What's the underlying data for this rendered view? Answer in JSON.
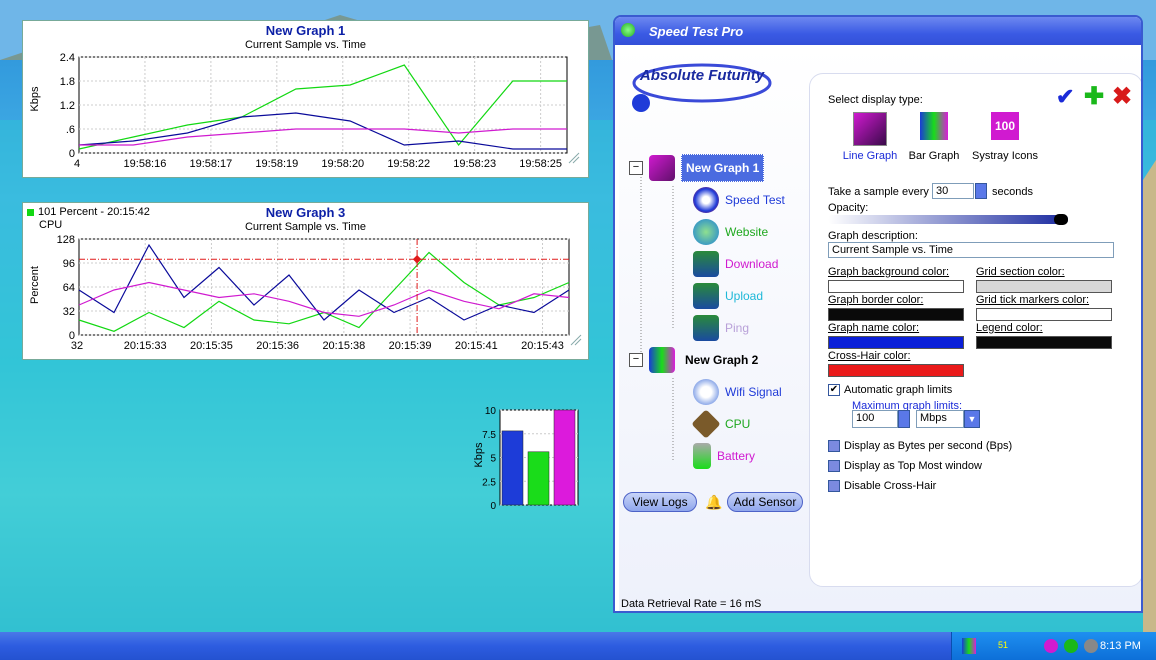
{
  "graph1": {
    "title": "New Graph 1",
    "subtitle": "Current Sample vs. Time",
    "ylabel": "Kbps",
    "yticks": [
      "2.4",
      "1.8",
      "1.2",
      ".6",
      "0"
    ],
    "xticks": [
      "4",
      "19:58:16",
      "19:58:17",
      "19:58:19",
      "19:58:20",
      "19:58:22",
      "19:58:23",
      "19:58:25"
    ]
  },
  "graph3": {
    "title": "New Graph 3",
    "subtitle": "Current Sample vs. Time",
    "status": "101 Percent - 20:15:42",
    "status_sub": "CPU",
    "ylabel": "Percent",
    "yticks": [
      "128",
      "96",
      "64",
      "32",
      "0"
    ],
    "xticks": [
      "32",
      "20:15:33",
      "20:15:35",
      "20:15:36",
      "20:15:38",
      "20:15:39",
      "20:15:41",
      "20:15:43"
    ]
  },
  "bar_widget": {
    "ylabel": "Kbps",
    "yticks": [
      "10",
      "7.5",
      "5",
      "2.5",
      "0"
    ]
  },
  "chart_data": [
    {
      "type": "line",
      "title": "New Graph 1",
      "subtitle": "Current Sample vs. Time",
      "ylabel": "Kbps",
      "ylim": [
        0,
        2.4
      ],
      "x": [
        "19:58:16",
        "19:58:17",
        "19:58:19",
        "19:58:20",
        "19:58:22",
        "19:58:23",
        "19:58:25"
      ],
      "series": [
        {
          "values": [
            0.1,
            0.4,
            0.7,
            0.9,
            1.6,
            1.7,
            2.2,
            0.2,
            1.8,
            1.8
          ],
          "color": "#12d812"
        },
        {
          "values": [
            0.2,
            0.3,
            0.5,
            0.9,
            1.0,
            0.8,
            0.2,
            0.3,
            0.1,
            0.1
          ],
          "color": "#0a0a9a"
        },
        {
          "values": [
            0.2,
            0.2,
            0.4,
            0.5,
            0.6,
            0.6,
            0.6,
            0.5,
            0.6,
            0.6
          ],
          "color": "#d01ad0"
        }
      ]
    },
    {
      "type": "line",
      "title": "New Graph 3",
      "subtitle": "Current Sample vs. Time",
      "ylabel": "Percent",
      "ylim": [
        0,
        128
      ],
      "x": [
        "20:15:33",
        "20:15:35",
        "20:15:36",
        "20:15:38",
        "20:15:39",
        "20:15:41",
        "20:15:43"
      ],
      "crosshair_value": 101,
      "series": [
        {
          "values": [
            20,
            5,
            30,
            10,
            45,
            20,
            15,
            30,
            10,
            60,
            110,
            70,
            40,
            50,
            70
          ],
          "color": "#12d812"
        },
        {
          "values": [
            60,
            30,
            120,
            50,
            90,
            40,
            80,
            20,
            60,
            30,
            50,
            20,
            40,
            30,
            60
          ],
          "color": "#0a0a9a"
        },
        {
          "values": [
            40,
            60,
            70,
            60,
            50,
            55,
            45,
            30,
            25,
            40,
            60,
            45,
            35,
            55,
            50
          ],
          "color": "#d01ad0"
        }
      ]
    },
    {
      "type": "bar",
      "ylabel": "Kbps",
      "ylim": [
        0,
        10
      ],
      "values": [
        7.8,
        5.6,
        10.2
      ],
      "colors": [
        "#1d3cd8",
        "#1adc1a",
        "#dc1adc"
      ]
    }
  ],
  "app": {
    "title": "Speed Test Pro",
    "logo_text": "Absolute Futurity",
    "tree": [
      {
        "label": "New Graph 1",
        "color": "#ffffff",
        "selected": true
      },
      {
        "label": "Speed Test",
        "color": "#1f3bd8"
      },
      {
        "label": "Website",
        "color": "#1fa81f"
      },
      {
        "label": "Download",
        "color": "#d01ad0"
      },
      {
        "label": "Upload",
        "color": "#1fb8d8"
      },
      {
        "label": "Ping",
        "color": "#b8a0d8"
      },
      {
        "label": "New Graph 2",
        "color": "#000000"
      },
      {
        "label": "Wifi Signal",
        "color": "#1f3bd8"
      },
      {
        "label": "CPU",
        "color": "#1fa81f"
      },
      {
        "label": "Battery",
        "color": "#d01ad0"
      }
    ],
    "view_logs": "View Logs",
    "add_sensor": "Add Sensor",
    "status": "Data Retrieval Rate = 16 mS",
    "panel": {
      "select_display": "Select display type:",
      "types": [
        "Line Graph",
        "Bar Graph",
        "Systray Icons"
      ],
      "sample_label": "Take a sample every",
      "sample_value": "30",
      "seconds": "seconds",
      "opacity": "Opacity:",
      "desc_label": "Graph description:",
      "desc_value": "Current Sample vs. Time",
      "bg_color": "Graph background color:",
      "grid_section": "Grid section color:",
      "border_color": "Graph border color:",
      "grid_tick": "Grid tick markers color:",
      "name_color": "Graph name color:",
      "legend_color": "Legend color:",
      "crosshair_color": "Cross-Hair color:",
      "auto_limits": "Automatic graph limits",
      "max_limits": "Maximum graph limits:",
      "max_value": "100",
      "unit": "Mbps",
      "bytes": "Display as Bytes per second (Bps)",
      "topmost": "Display as Top Most window",
      "disable_crosshair": "Disable Cross-Hair",
      "colors": {
        "bg": "#ffffff",
        "grid": "#d8d8d8",
        "border": "#0a0a0a",
        "tick": "#ffffff",
        "name": "#0a1fd8",
        "legend": "#0a0a0a",
        "crosshair": "#ea1a1a"
      }
    }
  },
  "tray": {
    "time": "8:13 PM",
    "mini": "51"
  }
}
